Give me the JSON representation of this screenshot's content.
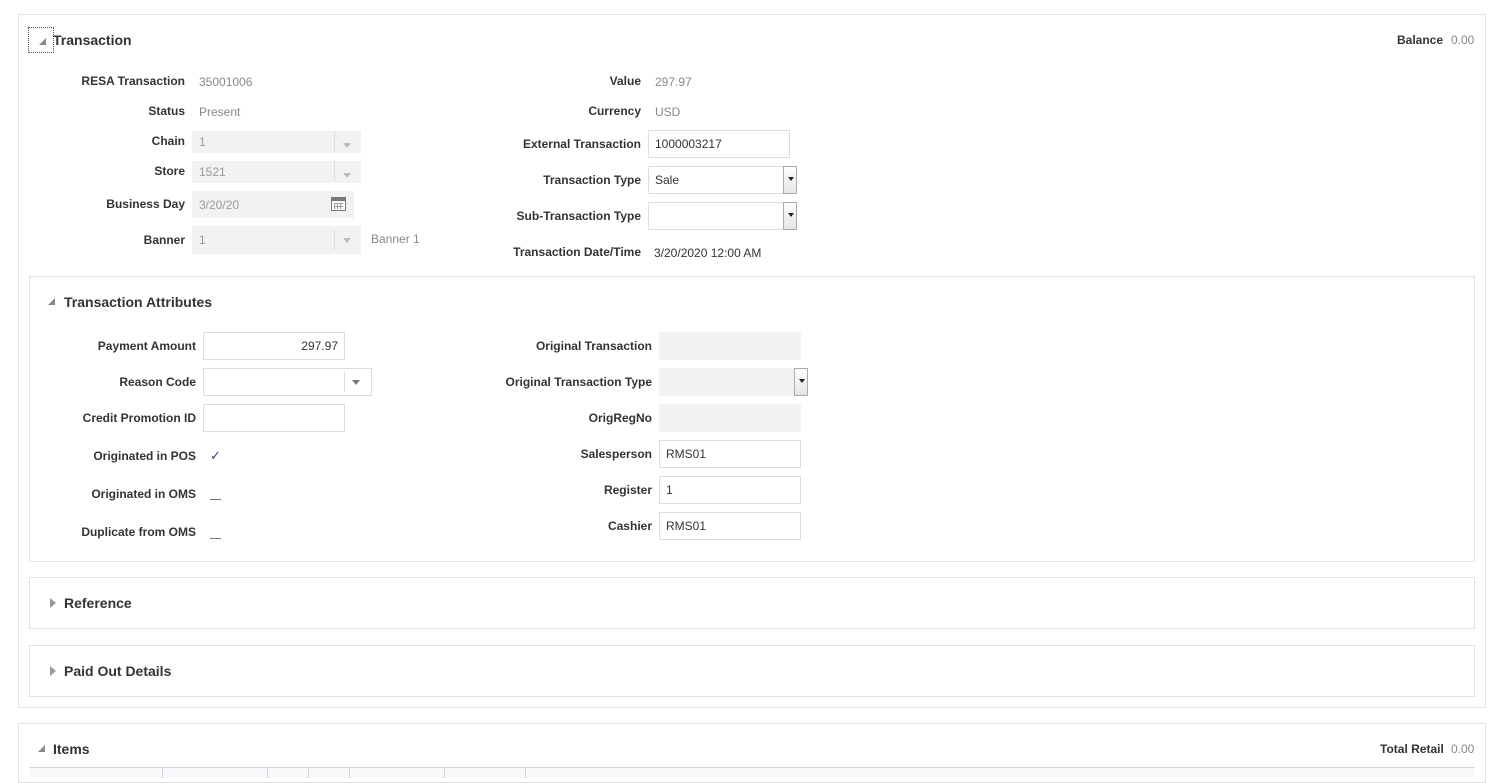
{
  "transaction": {
    "title": "Transaction",
    "balance_label": "Balance",
    "balance_value": "0.00",
    "left_fields": {
      "resa_transaction": {
        "label": "RESA Transaction",
        "value": "35001006"
      },
      "status": {
        "label": "Status",
        "value": "Present"
      },
      "chain": {
        "label": "Chain",
        "value": "1"
      },
      "store": {
        "label": "Store",
        "value": "1521"
      },
      "business_day": {
        "label": "Business Day",
        "value": "3/20/20"
      },
      "banner": {
        "label": "Banner",
        "value": "1",
        "name": "Banner 1"
      }
    },
    "right_fields": {
      "value": {
        "label": "Value",
        "value": "297.97"
      },
      "currency": {
        "label": "Currency",
        "value": "USD"
      },
      "external_transaction": {
        "label": "External Transaction",
        "value": "1000003217"
      },
      "transaction_type": {
        "label": "Transaction Type",
        "value": "Sale"
      },
      "sub_transaction_type": {
        "label": "Sub-Transaction Type",
        "value": ""
      },
      "transaction_datetime": {
        "label": "Transaction Date/Time",
        "value": "3/20/2020 12:00 AM"
      }
    }
  },
  "attributes": {
    "title": "Transaction Attributes",
    "payment_amount": {
      "label": "Payment Amount",
      "value": "297.97"
    },
    "reason_code": {
      "label": "Reason Code",
      "value": ""
    },
    "credit_promotion_id": {
      "label": "Credit Promotion ID",
      "value": ""
    },
    "originated_in_pos": {
      "label": "Originated in POS",
      "checked": true,
      "mark": "✓"
    },
    "originated_in_oms": {
      "label": "Originated in OMS",
      "checked": false
    },
    "duplicate_from_oms": {
      "label": "Duplicate from OMS",
      "checked": false
    },
    "original_transaction": {
      "label": "Original Transaction",
      "value": ""
    },
    "original_transaction_type": {
      "label": "Original Transaction Type",
      "value": ""
    },
    "orig_reg_no": {
      "label": "OrigRegNo",
      "value": ""
    },
    "salesperson": {
      "label": "Salesperson",
      "value": "RMS01"
    },
    "register": {
      "label": "Register",
      "value": "1"
    },
    "cashier": {
      "label": "Cashier",
      "value": "RMS01"
    }
  },
  "reference": {
    "title": "Reference"
  },
  "paid_out_details": {
    "title": "Paid Out Details"
  },
  "items": {
    "title": "Items",
    "total_retail_label": "Total Retail",
    "total_retail_value": "0.00"
  },
  "icons": {
    "expanded": "triangle-down-icon",
    "collapsed": "triangle-right-icon",
    "calendar": "calendar-icon",
    "dropdown": "chevron-down-icon"
  }
}
